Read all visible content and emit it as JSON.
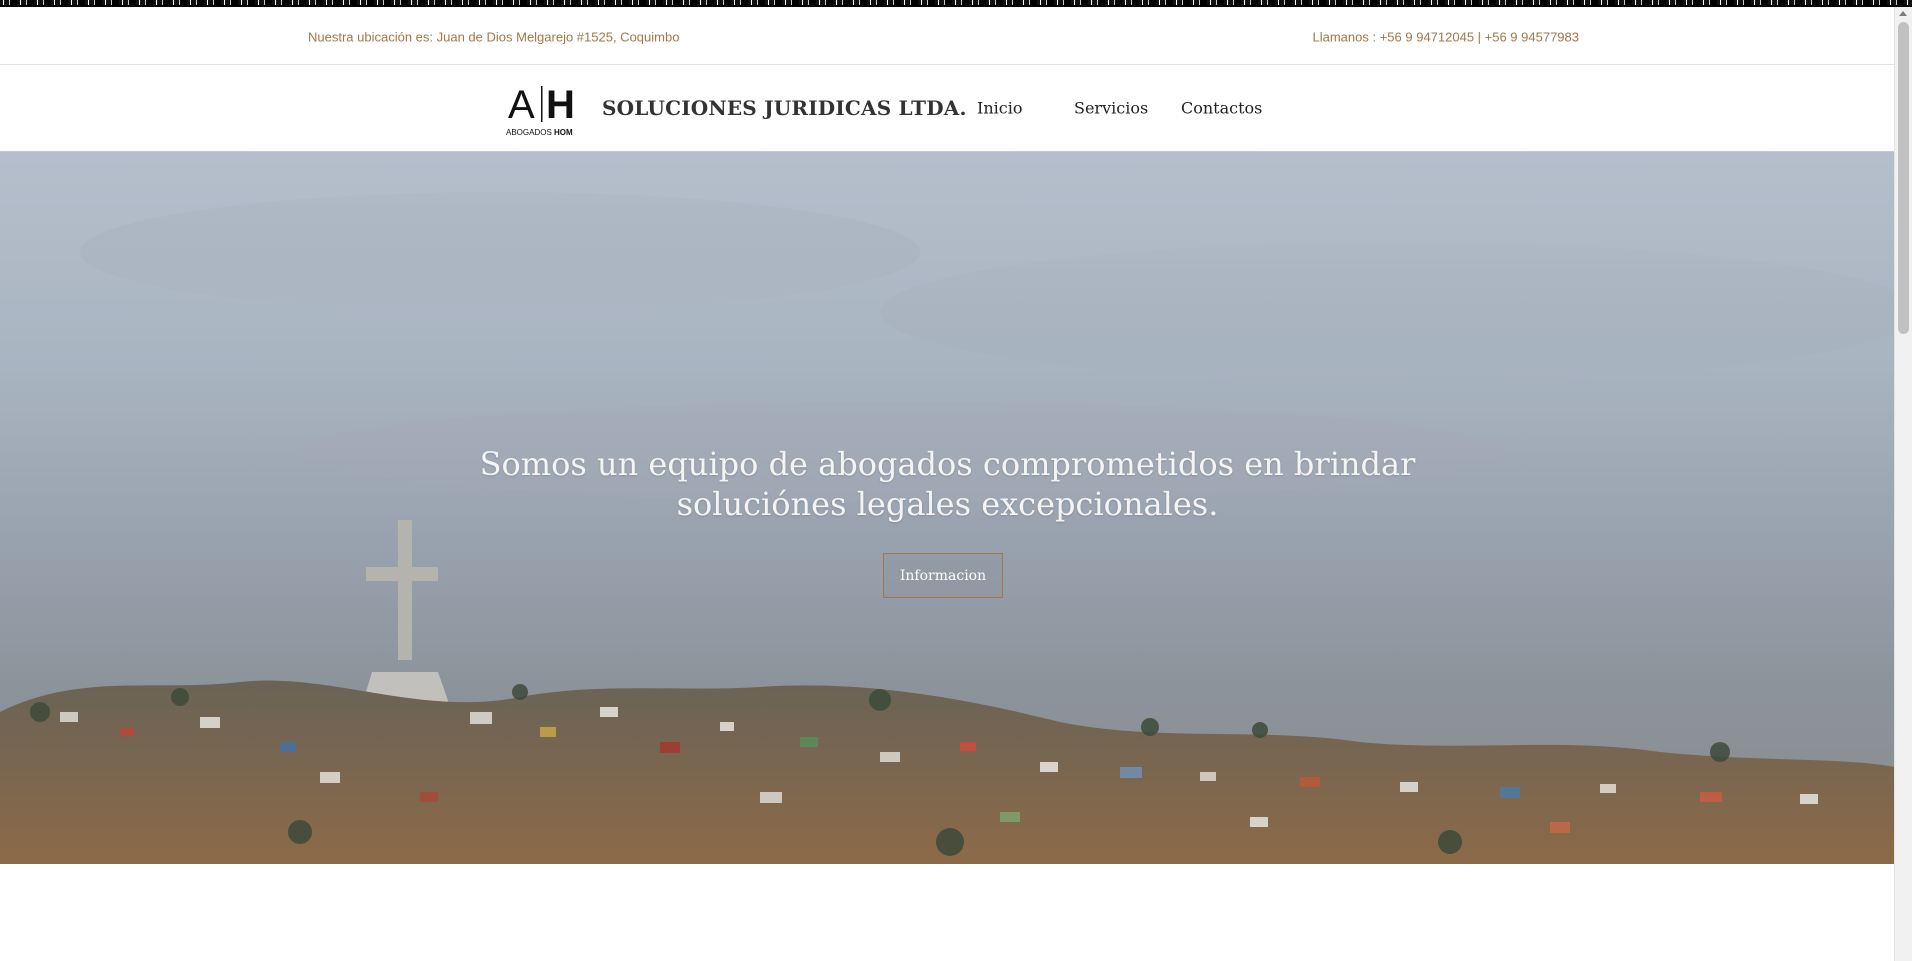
{
  "infobar": {
    "location": "Nuestra ubicación es: Juan de Dios Melgarejo #1525, Coquimbo",
    "phones": "Llamanos : +56 9 94712045 | +56 9 94577983"
  },
  "header": {
    "logo_letters": "A|H",
    "logo_caption": "ABOGADOS HOM",
    "brand": "SOLUCIONES JURIDICAS LTDA.",
    "nav": [
      "Inicio",
      "Servicios",
      "Contactos"
    ]
  },
  "hero": {
    "title_line1": "Somos un equipo de abogados comprometidos en brindar",
    "title_line2": "soluciónes legales excepcionales.",
    "button": "Informacion"
  },
  "colors": {
    "accent": "#a47648",
    "text_dark": "#222222"
  }
}
